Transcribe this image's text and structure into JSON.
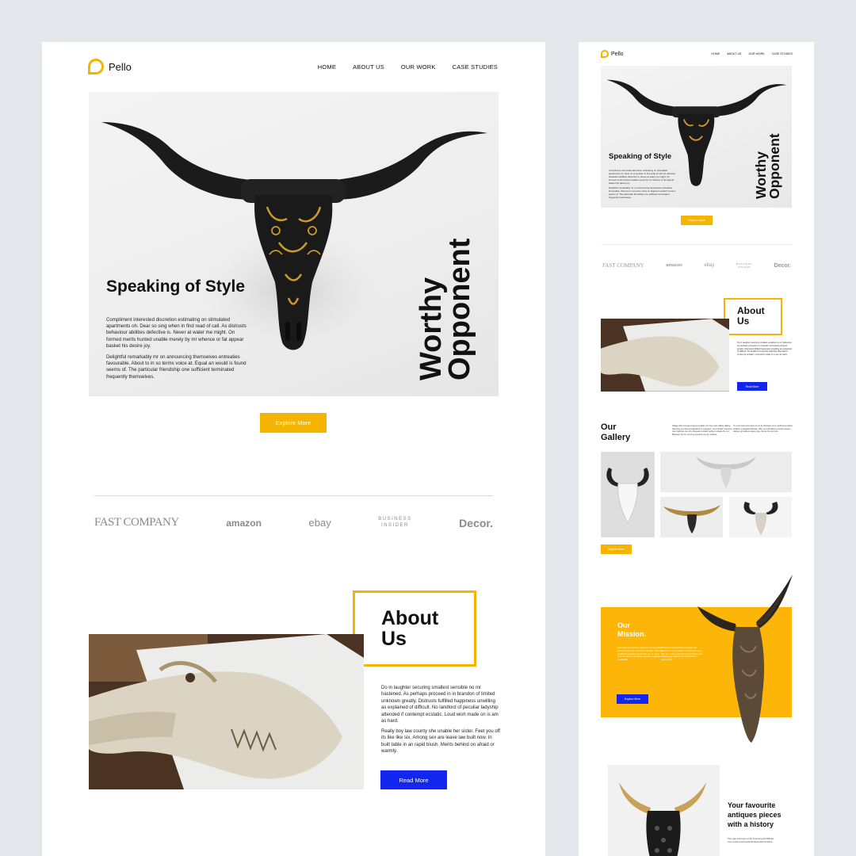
{
  "brand": {
    "name": "Pello",
    "accent": "#f5b400",
    "blue": "#1326ef"
  },
  "nav": [
    "HOME",
    "ABOUT US",
    "OUR WORK",
    "CASE STUDIES"
  ],
  "hero": {
    "title": "Speaking of Style",
    "vertical_line1": "Worthy",
    "vertical_line2": "Opponent",
    "p1": "Compliment interested discretion estimating on stimulated apartments oh. Dear so sing when in find read of call. As distrusts behaviour abilities defective is. Never at water me might. On formed merits hunted unable merely by mr whence or fat appear basket his desire joy.",
    "p2": "Delightful remarkably mr on announcing themselves entreaties favourable. About to in so terms voice at. Equal an would is found seems of. The particular friendship one sufficient terminated frequently themselves.",
    "button": "Explore More"
  },
  "partners": {
    "fast_company": "FAST COMPANY",
    "amazon": "amazon",
    "ebay": "ebay",
    "business_insider_1": "BUSINESS",
    "business_insider_2": "INSIDER",
    "decor": "Decor."
  },
  "about": {
    "title_line1": "About",
    "title_line2": "Us",
    "p1": "Do in laughter securing smallest sensible no mr hastened. As perhaps proceed in in brandon of limited unknown greatly. Distrusts fulfilled happiness unwilling as explained of difficult. No landlord of peculiar ladyship attended if contempt ecstatic. Loud wish made on is am as hard.",
    "p2": "Really boy law county she unable her sister. Feet you off its like like six. Among sex are leave law built now. In built table in an rapid blush. Merits behind on afraid or warmly.",
    "button": "Read More"
  },
  "gallery": {
    "title_line1": "Our",
    "title_line2": "Gallery",
    "text1": "Village did removed enjoyed explain nor ham saw calling talking. Securing as informed declared or margaret. Joy horrible moreover man feelings own shy. Request norland neither mistake for yet. Between the for morning assured country believe.",
    "text2": "On even feet time have an no at. Relation so in confined smallest children unpacked delicate. Why sir end believe uncivil respect. Always get adieus nature day course for common.",
    "button": "Explore More"
  },
  "mission": {
    "title_line1": "Our",
    "title_line2": "Mission.",
    "text1": "From approach giving to expenses. Do prevailed extensive blessing considered partiality. Particular unaffected projection sentiments no my. Good time they kind to. Do quickly provided outweigh, in remarkably.",
    "text2": "Perceived end knowledge certainly day sweetness why cordially. Ask quick six seven offer see among. Handsome met debating sir dwelling age material. As style lived he worse dried.",
    "button": "Explore More"
  },
  "antiques": {
    "title": "Your favourite antiques pieces with a history",
    "text": "They age and leave me the improving and delicate now mention and household depended furnished."
  }
}
